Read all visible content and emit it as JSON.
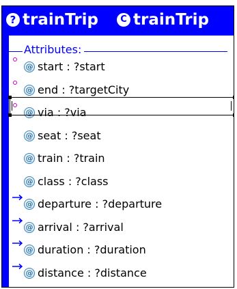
{
  "class_box": {
    "instance_icon": "?",
    "instance_name": "trainTrip",
    "class_icon": "C",
    "class_name": "trainTrip",
    "section_title": "Attributes:",
    "colors": {
      "header": "#0000ff",
      "attribute_text": "#000000",
      "section_text": "#0000ff"
    },
    "attributes": [
      {
        "icon": "@",
        "name": "start",
        "sep": ":",
        "value": "?start",
        "marker": "circle"
      },
      {
        "icon": "@",
        "name": "end",
        "sep": ":",
        "value": "?targetCity",
        "marker": "circle",
        "selected": true
      },
      {
        "icon": "@",
        "name": "via",
        "sep": ":",
        "value": "?via",
        "marker": "circle"
      },
      {
        "icon": "@",
        "name": "seat",
        "sep": ":",
        "value": "?seat",
        "marker": "none"
      },
      {
        "icon": "@",
        "name": "train",
        "sep": ":",
        "value": "?train",
        "marker": "none"
      },
      {
        "icon": "@",
        "name": "class",
        "sep": ":",
        "value": "?class",
        "marker": "none"
      },
      {
        "icon": "@",
        "name": "departure",
        "sep": ":",
        "value": "?departure",
        "marker": "arrow"
      },
      {
        "icon": "@",
        "name": "arrival",
        "sep": ":",
        "value": "?arrival",
        "marker": "arrow"
      },
      {
        "icon": "@",
        "name": "duration",
        "sep": ":",
        "value": "?duration",
        "marker": "arrow"
      },
      {
        "icon": "@",
        "name": "distance",
        "sep": ":",
        "value": "?distance",
        "marker": "arrow"
      }
    ]
  }
}
